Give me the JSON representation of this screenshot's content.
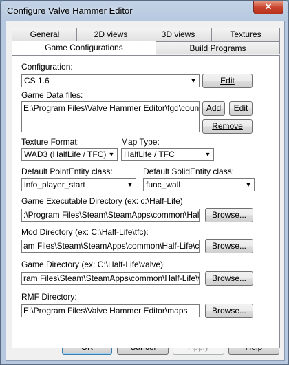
{
  "window": {
    "title": "Configure Valve Hammer Editor",
    "close_glyph": "✕"
  },
  "tabs": {
    "row1": [
      "General",
      "2D views",
      "3D views",
      "Textures"
    ],
    "row2": [
      "Game Configurations",
      "Build Programs"
    ]
  },
  "form": {
    "configuration": {
      "label": "Configuration:",
      "value": "CS 1.6",
      "edit_label": "Edit"
    },
    "game_data_files": {
      "label": "Game Data files:",
      "value": "E:\\Program Files\\Valve Hammer Editor\\fgd\\counter-strike.fgd",
      "add_label": "Add",
      "edit_label": "Edit",
      "remove_label": "Remove"
    },
    "texture_format": {
      "label": "Texture Format:",
      "value": "WAD3 (HalfLife / TFC)"
    },
    "map_type": {
      "label": "Map Type:",
      "value": "HalfLife / TFC"
    },
    "default_point_entity": {
      "label": "Default PointEntity class:",
      "value": "info_player_start"
    },
    "default_solid_entity": {
      "label": "Default SolidEntity class:",
      "value": "func_wall"
    },
    "game_executable_dir": {
      "label": "Game Executable Directory (ex: c:\\Half-Life)",
      "value": ":\\Program Files\\Steam\\SteamApps\\common\\Half-Life",
      "browse_label": "Browse..."
    },
    "mod_dir": {
      "label": "Mod Directory (ex: C:\\Half-Life\\tfc):",
      "value": "am Files\\Steam\\SteamApps\\common\\Half-Life\\cstrike",
      "browse_label": "Browse..."
    },
    "game_dir": {
      "label": "Game Directory (ex: C:\\Half-Life\\valve)",
      "value": "ram Files\\Steam\\SteamApps\\common\\Half-Life\\valve",
      "browse_label": "Browse..."
    },
    "rmf_dir": {
      "label": "RMF Directory:",
      "value": "E:\\Program Files\\Valve Hammer Editor\\maps",
      "browse_label": "Browse..."
    }
  },
  "footer": {
    "ok": "OK",
    "cancel": "Cancel",
    "apply": "Apply",
    "help": "Help"
  }
}
